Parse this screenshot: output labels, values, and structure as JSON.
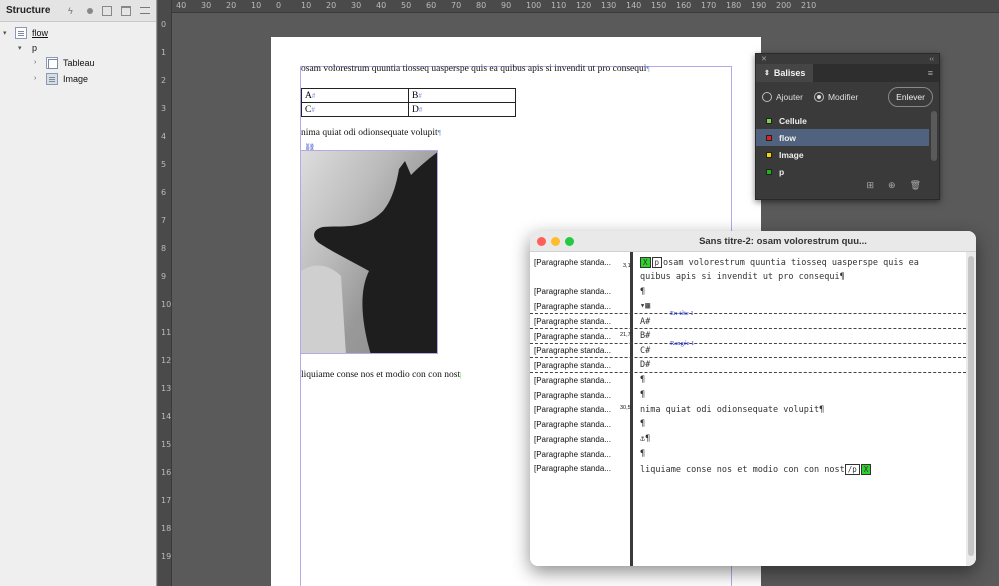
{
  "structure": {
    "title": "Structure",
    "nodes": [
      {
        "label": "flow",
        "level": 0
      },
      {
        "label": "p",
        "level": 1
      },
      {
        "label": "Tableau",
        "level": 2
      },
      {
        "label": "Image",
        "level": 2
      }
    ]
  },
  "ruler": {
    "h_ticks": [
      "40",
      "30",
      "20",
      "10",
      "0",
      "10",
      "20",
      "30",
      "40",
      "50",
      "60",
      "70",
      "80",
      "90",
      "100",
      "110",
      "120",
      "130",
      "140",
      "150",
      "160",
      "170",
      "180",
      "190",
      "200",
      "210"
    ],
    "v_ticks": [
      "0",
      "1",
      "2",
      "3",
      "4",
      "5",
      "6",
      "7",
      "8",
      "9",
      "10",
      "11",
      "12",
      "13",
      "14",
      "15",
      "16",
      "17",
      "18",
      "19"
    ]
  },
  "document": {
    "line1": "osam volorestrum quuntia tiosseq uasperspe quis ea quibus apis si invendit ut pro consequi",
    "table": [
      [
        "A",
        "B"
      ],
      [
        "C",
        "D"
      ]
    ],
    "line2": "nima quiat odi odionsequate volupit",
    "line3": "liquiame conse nos et modio con con nost"
  },
  "balises": {
    "tab": "Balises",
    "radio_add": "Ajouter",
    "radio_modify": "Modifier",
    "remove_button": "Enlever",
    "tags": [
      {
        "name": "Cellule",
        "color": "#7bd14a"
      },
      {
        "name": "flow",
        "color": "#e0211c",
        "selected": true
      },
      {
        "name": "Image",
        "color": "#f2d400"
      },
      {
        "name": "p",
        "color": "#18b618"
      }
    ]
  },
  "story": {
    "title": "Sans titre-2: osam volorestrum quu...",
    "para_label": "[Paragraphe standa...",
    "depths": {
      "r1": "3,1",
      "r6": "21,7",
      "r11": "30,5"
    },
    "line1": "osam volorestrum quuntia tiosseq uasperspe quis ea",
    "line1b": "quibus apis si invendit ut pro consequi¶",
    "pilcrow": "¶",
    "cell_a": "A#",
    "cell_b": "B#",
    "cell_c": "C#",
    "cell_d": "D#",
    "header_label": "En-tête 1",
    "row_label": "Rangée 1",
    "line_nima": "nima quiat odi odionsequate volupit¶",
    "line_liquiame": "liquiame conse nos et modio con con nost",
    "tag_p": "p",
    "tag_x": "X",
    "tag_close": "/p"
  }
}
